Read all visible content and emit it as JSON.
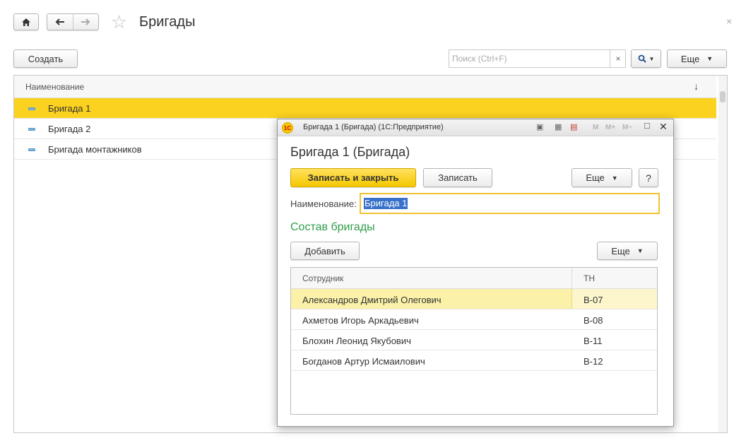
{
  "main": {
    "title": "Бригады",
    "create_label": "Создать",
    "search_placeholder": "Поиск (Ctrl+F)",
    "search_clear_glyph": "×",
    "more_label": "Еще",
    "close_glyph": "×",
    "list": {
      "header": "Наименование",
      "sort_glyph": "↓",
      "rows": [
        {
          "name": "Бригада 1",
          "selected": true
        },
        {
          "name": "Бригада 2",
          "selected": false
        },
        {
          "name": "Бригада монтажников",
          "selected": false
        }
      ]
    }
  },
  "modal": {
    "window_title": "Бригада 1 (Бригада)  (1С:Предприятие)",
    "logo_text": "1С",
    "titlebar_tools": [
      "M",
      "M+",
      "M−"
    ],
    "heading": "Бригада 1 (Бригада)",
    "save_close_label": "Записать и закрыть",
    "save_label": "Записать",
    "more_label": "Еще",
    "help_label": "?",
    "name_label": "Наименование:",
    "name_value": "Бригада 1",
    "section_title": "Состав бригады",
    "add_label": "Добавить",
    "table": {
      "columns": [
        "Сотрудник",
        "ТН"
      ],
      "rows": [
        {
          "employee": "Александров Дмитрий Олегович",
          "tn": "В-07",
          "selected": true
        },
        {
          "employee": "Ахметов Игорь Аркадьевич",
          "tn": "В-08",
          "selected": false
        },
        {
          "employee": "Блохин Леонид Якубович",
          "tn": "В-11",
          "selected": false
        },
        {
          "employee": "Богданов Артур Исмаилович",
          "tn": "В-12",
          "selected": false
        }
      ]
    }
  },
  "icons": {
    "home": "home-icon",
    "back": "arrow-left-icon",
    "forward": "arrow-right-icon",
    "favorite": "star-icon",
    "search": "search-icon"
  },
  "colors": {
    "selection_yellow": "#fbd21f",
    "primary_button": "#f5c800",
    "section_green": "#2e9e4b",
    "row_selected_light": "#fbf1a8"
  }
}
